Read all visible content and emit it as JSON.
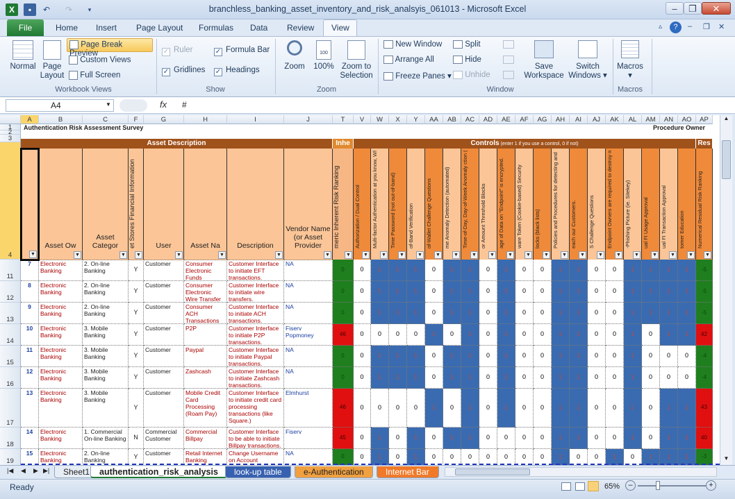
{
  "window": {
    "title": "branchless_banking_asset_inventory_and_risk_analsyis_061013 - Microsoft Excel"
  },
  "ribbon_tabs": [
    "File",
    "Home",
    "Insert",
    "Page Layout",
    "Formulas",
    "Data",
    "Review",
    "View"
  ],
  "ribbon": {
    "workbook_views": {
      "label": "Workbook Views",
      "normal": "Normal",
      "page_layout": "Page Layout",
      "page_break": "Page Break Preview",
      "custom": "Custom Views",
      "full": "Full Screen"
    },
    "show": {
      "label": "Show",
      "ruler": "Ruler",
      "formula_bar": "Formula Bar",
      "gridlines": "Gridlines",
      "headings": "Headings"
    },
    "zoom": {
      "label": "Zoom",
      "zoom": "Zoom",
      "p100": "100%",
      "sel": "Zoom to Selection"
    },
    "window": {
      "label": "Window",
      "new_window": "New Window",
      "arrange": "Arrange All",
      "freeze": "Freeze Panes",
      "split": "Split",
      "hide": "Hide",
      "unhide": "Unhide",
      "save_ws": "Save Workspace",
      "switch": "Switch Windows"
    },
    "macros": {
      "label": "Macros",
      "macros": "Macros"
    }
  },
  "formula": {
    "name_box": "A4",
    "fx": "fx",
    "value": "#"
  },
  "sheet": {
    "row1_title": "Authentication Risk Assessment Survey",
    "row1_right": "Procedure Owner",
    "section_asset": "Asset Description",
    "section_inhe": "Inhe",
    "section_controls": "Controls",
    "section_controls_note": "(enter 1 if you use a control, 0 if not)",
    "section_res": "Res",
    "col_letters": [
      "A",
      "B",
      "C",
      "F",
      "G",
      "H",
      "I",
      "J",
      "T",
      "V",
      "W",
      "X",
      "Y",
      "AA",
      "AB",
      "AC",
      "AD",
      "AE",
      "AF",
      "AG",
      "AH",
      "AI",
      "AJ",
      "AK",
      "AL",
      "AM",
      "AN",
      "AO",
      "AP"
    ],
    "headers_horizontal": [
      "",
      "Asset Ow",
      "Asset Categor",
      "",
      "User",
      "Asset Na",
      "Description",
      "Vendor Name (or Asset Provider"
    ],
    "header_f": "et Stores Financial Information",
    "header_t": "meric Inherent Risk Ranking",
    "headers_controls": [
      "Authorization / Dual Control",
      "Multi-factor Authentication at you know, What you have)",
      "Time Password (not out-of-band)",
      "of-Band Verification",
      "of-Wallet Challenge Questions",
      "me Anomaly Detection (automated)",
      "Time-of-Day, Day-of-Week Anomaly ction (automated)",
      "or Amount Threshold Blocks",
      "age of Data on \"Endpoint\" is encrypted.",
      "ware Token (Cookie-based) Security",
      "locks (black lists)",
      "Policies and Procedures for detecting and onding to fraud",
      "each our Customers.",
      "S Challenge Questions",
      "Endpoint Owners are required to destroy mulated NPI.",
      "-Phishing Picture (ie. Sitekey)",
      "ual FI Usage Approval",
      "ual FI Transaction Approval",
      "tomer Education"
    ],
    "header_ap": "Numerical Residual Risk Ranking",
    "row_numbers": [
      "1",
      "2",
      "3",
      "4",
      "11",
      "12",
      "13",
      "14",
      "15",
      "16",
      "17",
      "18",
      "19"
    ],
    "rows": [
      {
        "a": "7",
        "b": "Electronic Banking",
        "c": "2. On-line Banking",
        "f": "Y",
        "g": "Customer",
        "h": "Consumer Electronic Funds Transfer",
        "i": "Customer Interface to initiate EFT transactions.",
        "j": "NA",
        "t": "0",
        "ap": "-5",
        "tc": "grn",
        "apc": "grn"
      },
      {
        "a": "8",
        "b": "Electronic Banking",
        "c": "2. On-line Banking",
        "f": "Y",
        "g": "Customer",
        "h": "Consumer Electronic Wire Transfer",
        "i": "Customer Interface to initiate wire transfers.",
        "j": "NA",
        "t": "0",
        "ap": "-5",
        "tc": "grn",
        "apc": "grn"
      },
      {
        "a": "9",
        "b": "Electronic Banking",
        "c": "2. On-line Banking",
        "f": "Y",
        "g": "Customer",
        "h": "Consumer ACH Transactions",
        "i": "Customer Interface to initiate ACH transactions.",
        "j": "NA",
        "t": "0",
        "ap": "-5",
        "tc": "grn",
        "apc": "grn"
      },
      {
        "a": "10",
        "b": "Electronic Banking",
        "c": "3. Mobile Banking",
        "f": "Y",
        "g": "Customer",
        "h": "P2P",
        "i": "Customer Interface to initiate P2P transactions.",
        "j": "Fiserv Popmoney",
        "t": "46",
        "ap": "42",
        "tc": "redc",
        "apc": "redc"
      },
      {
        "a": "11",
        "b": "Electronic Banking",
        "c": "3. Mobile Banking",
        "f": "Y",
        "g": "Customer",
        "h": "Paypal",
        "i": "Customer Interface to initiate Paypal transactions.",
        "j": "NA",
        "t": "0",
        "ap": "-4",
        "tc": "grn",
        "apc": "grn"
      },
      {
        "a": "12",
        "b": "Electronic Banking",
        "c": "3. Mobile Banking",
        "f": "Y",
        "g": "Customer",
        "h": "Zashcash",
        "i": "Customer Interface to initiate Zashcash transactions.",
        "j": "NA",
        "t": "0",
        "ap": "-4",
        "tc": "grn",
        "apc": "grn"
      },
      {
        "a": "13",
        "b": "Electronic Banking",
        "c": "3. Mobile Banking",
        "f": "Y",
        "g": "Customer",
        "h": "Mobile Credit Card Processing (Roam Pay)",
        "i": "Customer Interface to initiate credit card processing transactions (like Square.)",
        "j": "Elmhurst",
        "t": "46",
        "ap": "43",
        "tc": "redc",
        "apc": "redc"
      },
      {
        "a": "14",
        "b": "Electronic Banking",
        "c": "1. Commercial On-line Banking",
        "f": "N",
        "g": "Commercial Customer",
        "h": "Commercial Billpay",
        "i": "Customer Interface to be able to initiate Billpay transactions.",
        "j": "Fiserv",
        "t": "45",
        "ap": "40",
        "tc": "redc",
        "apc": "redc"
      },
      {
        "a": "15",
        "b": "Electronic Banking",
        "c": "2. On-line Banking",
        "f": "Y",
        "g": "Customer",
        "h": "Retail Internet Banking",
        "i": "Change Username on Account",
        "j": "NA",
        "t": "0",
        "ap": "-3",
        "tc": "grn",
        "apc": "grn"
      }
    ],
    "controls": [
      [
        "0",
        "1",
        "1",
        "1",
        "0",
        "1",
        "1",
        "0",
        "1",
        "0",
        "0",
        "1",
        "1",
        "0",
        "0",
        "1",
        "1",
        "1",
        "1"
      ],
      [
        "0",
        "1",
        "1",
        "1",
        "0",
        "1",
        "1",
        "0",
        "1",
        "0",
        "0",
        "1",
        "1",
        "0",
        "0",
        "1",
        "1",
        "1",
        "1"
      ],
      [
        "0",
        "1",
        "1",
        "1",
        "0",
        "1",
        "1",
        "0",
        "1",
        "0",
        "0",
        "1",
        "1",
        "0",
        "0",
        "1",
        "1",
        "1",
        "1"
      ],
      [
        "0",
        "0",
        "0",
        "0",
        "1",
        "0",
        "1",
        "0",
        "1",
        "0",
        "0",
        "1",
        "1",
        "0",
        "0",
        "1",
        "0",
        "1",
        "1"
      ],
      [
        "0",
        "1",
        "1",
        "1",
        "0",
        "1",
        "1",
        "0",
        "1",
        "0",
        "0",
        "1",
        "1",
        "0",
        "0",
        "1",
        "0",
        "0",
        "0"
      ],
      [
        "0",
        "1",
        "1",
        "1",
        "0",
        "1",
        "1",
        "0",
        "1",
        "0",
        "0",
        "1",
        "1",
        "0",
        "0",
        "1",
        "0",
        "0",
        "0"
      ],
      [
        "0",
        "0",
        "0",
        "0",
        "1",
        "0",
        "1",
        "0",
        "1",
        "0",
        "0",
        "1",
        "1",
        "0",
        "0",
        "1",
        "0",
        "1",
        "1"
      ],
      [
        "0",
        "1",
        "0",
        "1",
        "0",
        "1",
        "1",
        "0",
        "0",
        "0",
        "0",
        "1",
        "1",
        "0",
        "0",
        "1",
        "0",
        "1",
        "1"
      ],
      [
        "0",
        "1",
        "0",
        "1",
        "0",
        "0",
        "0",
        "0",
        "0",
        "0",
        "0",
        "1",
        "0",
        "0",
        "1",
        "0",
        "1",
        "1",
        "1"
      ]
    ]
  },
  "sheet_tabs": [
    "Sheet1",
    "authentication_risk_analysis",
    "look-up table",
    "e-Authentication",
    "Internet Bar"
  ],
  "status": {
    "ready": "Ready",
    "zoom": "65%"
  }
}
